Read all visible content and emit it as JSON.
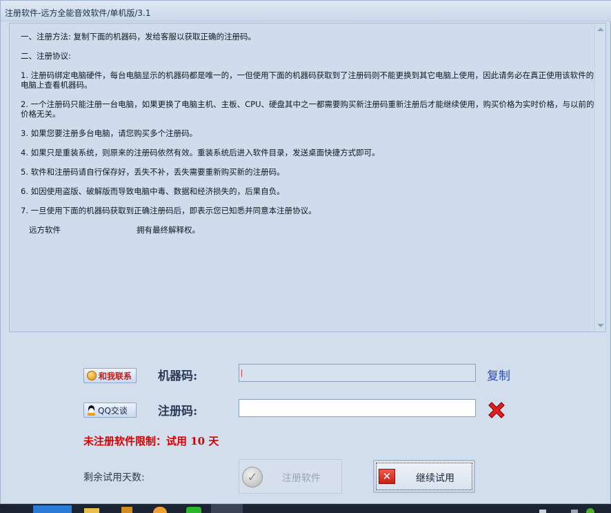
{
  "window": {
    "title": "注册软件-远方全能音效软件/单机版/3.1"
  },
  "agreement": {
    "paragraphs": [
      "一、注册方法: 复制下面的机器码，发给客服以获取正确的注册码。",
      "二、注册协议:",
      "1. 注册码绑定电脑硬件，每台电脑显示的机器码都是唯一的，一但使用下面的机器码获取到了注册码则不能更换到其它电脑上使用，因此请务必在真正使用该软件的电脑上查看机器码。",
      "2. 一个注册码只能注册一台电脑，如果更换了电脑主机、主板、CPU、硬盘其中之一都需要购买新注册码重新注册后才能继续使用，购买价格为实时价格，与以前的价格无关。",
      "3. 如果您要注册多台电脑，请您购买多个注册码。",
      "4. 如果只是重装系统，则原来的注册码依然有效。重装系统后进入软件目录，发送桌面快捷方式即可。",
      "5. 软件和注册码请自行保存好，丢失不补，丢失需要重新购买新的注册码。",
      "6. 如因使用盗版、破解版而导致电脑中毒、数据和经济损失的，后果自负。",
      "7. 一旦使用下面的机器码获取到正确注册码后，即表示您已知悉并同意本注册协议。"
    ],
    "footer_company": "远方软件",
    "footer_rights": "拥有最终解释权。"
  },
  "contact": {
    "contact_label": "和我联系",
    "qq_label": "QQ交谈"
  },
  "form": {
    "machine_code_label": "机器码:",
    "machine_code_value": "",
    "copy_label": "复制",
    "reg_code_label": "注册码:",
    "reg_code_value": ""
  },
  "status": {
    "limit_text": "未注册软件限制：试用  10  天",
    "remaining_label": "剩余试用天数:"
  },
  "buttons": {
    "register_label": "注册软件",
    "continue_label": "继续试用"
  },
  "colors": {
    "limit_red": "#d40000",
    "link_blue": "#2b4fb0"
  }
}
